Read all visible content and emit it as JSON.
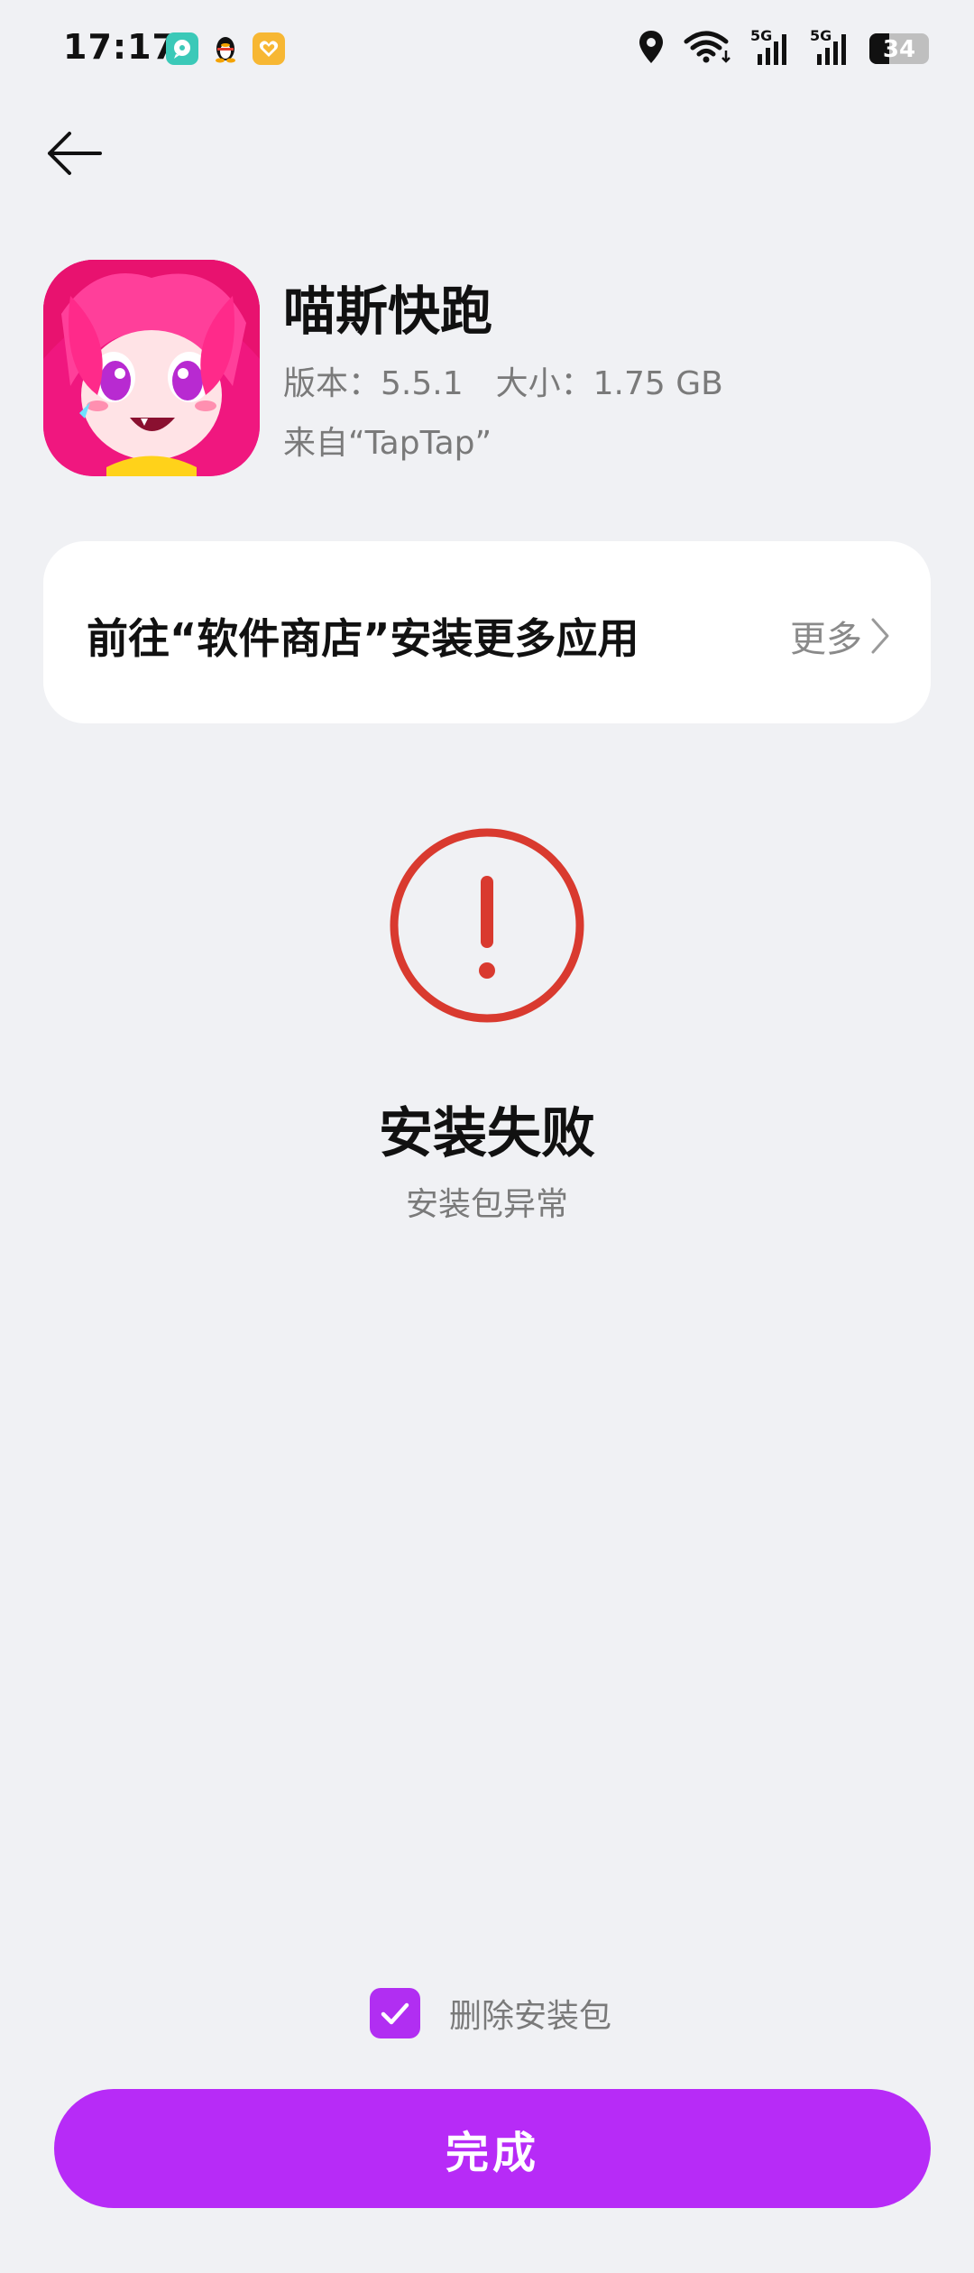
{
  "status_bar": {
    "time": "17:17",
    "signal_1_label": "5G",
    "signal_2_label": "5G",
    "battery_level": "34",
    "battery_percent": 34,
    "icons": [
      "chat-bubble-icon",
      "qq-penguin-icon",
      "heart-badge-icon",
      "location-icon",
      "wifi-icon",
      "signal-icon",
      "signal-icon",
      "battery-icon"
    ]
  },
  "nav": {
    "back_icon": "back-arrow-icon"
  },
  "app": {
    "name": "喵斯快跑",
    "version": "版本：5.5.1",
    "size": "大小：1.75 GB",
    "source": "来自“TapTap”"
  },
  "store_card": {
    "text": "前往“软件商店”安装更多应用",
    "more": "更多"
  },
  "result": {
    "icon": "exclamation-circle-icon",
    "title": "安装失败",
    "subtitle": "安装包异常"
  },
  "delete_option": {
    "label": "删除安装包",
    "checked": true
  },
  "actions": {
    "done": "完成"
  },
  "colors": {
    "accent": "#b72bf7",
    "error": "#d93a2f",
    "background": "#f0f1f4",
    "card": "#ffffff"
  }
}
